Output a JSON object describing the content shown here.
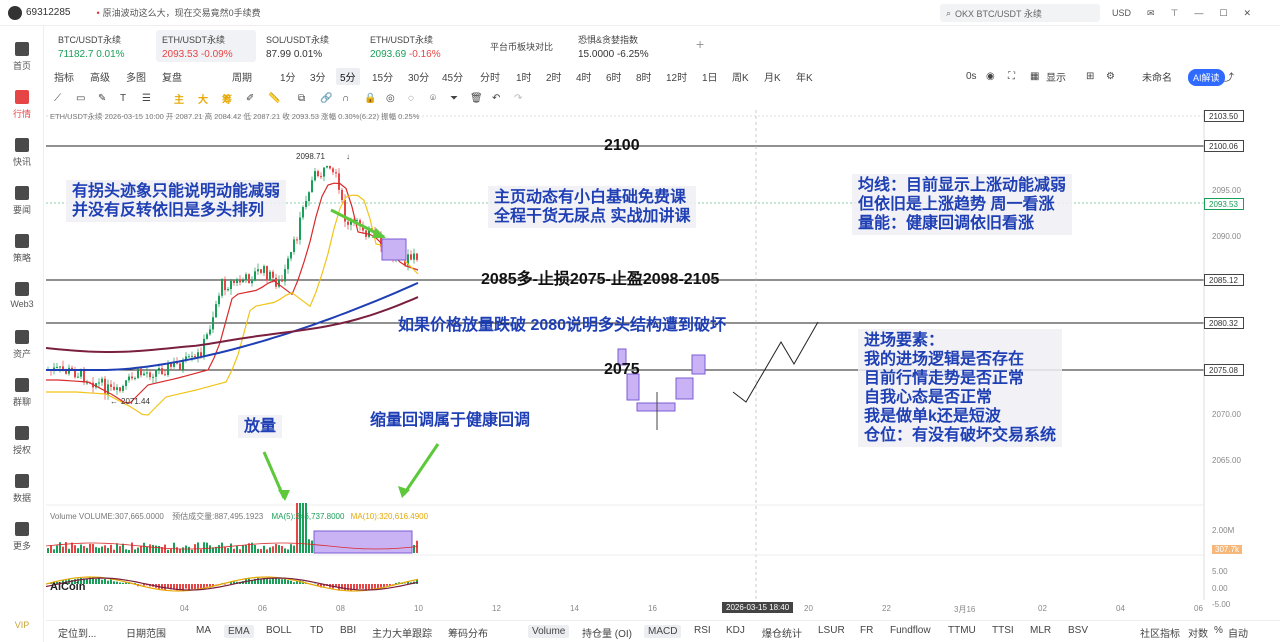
{
  "titlebar": {
    "user_id": "69312285",
    "marquee": "原油波动这么大，现在交易竟然0手续费",
    "search_placeholder": "OKX BTC/USDT 永续",
    "currency": "USD"
  },
  "nav": {
    "items": [
      "首页",
      "行情",
      "快讯",
      "要闻",
      "策略",
      "Web3",
      "资产",
      "群聊",
      "授权",
      "数据",
      "更多"
    ],
    "active": "行情",
    "vip": "VIP"
  },
  "tickers": [
    {
      "name": "BTC/USDT永续",
      "price": "71182.7",
      "change": "0.01%",
      "dir": "up"
    },
    {
      "name": "ETH/USDT永续",
      "price": "2093.53",
      "change": "-0.09%",
      "dir": "dn"
    },
    {
      "name": "SOL/USDT永续",
      "price": "87.99",
      "change": "0.01%",
      "dir": "neutral"
    },
    {
      "name": "ETH/USDT永续",
      "price": "2093.69",
      "change": "-0.16%",
      "dir": "up"
    },
    {
      "name": "平台币板块对比",
      "price": "",
      "change": "",
      "dir": "neutral"
    },
    {
      "name": "恐惧&贪婪指数",
      "price": "15.0000",
      "change": "-6.25%",
      "dir": "neutral"
    }
  ],
  "toolbar1": {
    "left": [
      "指标",
      "高级",
      "多图",
      "复盘"
    ],
    "period_label": "周期",
    "periods": [
      "1分",
      "3分",
      "5分",
      "15分",
      "30分",
      "45分",
      "分时",
      "1时",
      "2时",
      "4时",
      "6时",
      "8时",
      "12时",
      "1日",
      "周K",
      "月K",
      "年K"
    ],
    "selected_period": "5分",
    "right": [
      "0s",
      "显示",
      "未命名"
    ],
    "ai_button": "AI解读"
  },
  "toolbar2": {
    "labels": [
      "主",
      "大",
      "筹"
    ]
  },
  "info_line": "ETH/USDT永续 2026-03-15 10:00 开 2087.21 高 2084.42 低 2087.21 收 2093.53 涨幅 0.30%(6.22) 振幅 0.25%",
  "volume_line": {
    "volume": "Volume VOLUME:307,665.0000",
    "est": "预估成交量:887,495.1923",
    "ma5": "MA(5):346,737.8000",
    "ma10": "MA(10):320,616.4900"
  },
  "annotations": {
    "left_top_1": "有拐头迹象只能说明动能减弱",
    "left_top_2": "并没有反转依旧是多头排列",
    "mid_top_1": "主页动态有小白基础免费课",
    "mid_top_2": "全程干货无尿点 实战加讲课",
    "right_top_1": "均线：目前显示上涨动能减弱",
    "right_top_2": "但依旧是上涨趋势 周一看涨",
    "right_top_3": "量能：健康回调依旧看涨",
    "level_2100": "2100",
    "trade_plan": "2085多-止损2075-止盈2098-2105",
    "breakdown": "如果价格放量跌破 2080说明多头结构遭到破坏",
    "level_2075": "2075",
    "entry_title": "进场要素：",
    "entry_1": "我的进场逻辑是否存在",
    "entry_2": "目前行情走势是否正常",
    "entry_3": "自我心态是否正常",
    "entry_4": "我是做单k还是短波",
    "entry_5": "仓位：有没有破坏交易系统",
    "volume_up": "放量",
    "volume_down": "缩量回调属于健康回调",
    "high_label": "2098.71",
    "low_label": "2071.44"
  },
  "price_axis": {
    "tags": [
      "2103.50",
      "2100.06",
      "2093.53",
      "2085.12",
      "2080.32",
      "2075.08"
    ],
    "labels": [
      "2095.00",
      "2090.00",
      "2070.00",
      "2065.00"
    ],
    "vol_labels": [
      "2.00M",
      "307.7k",
      "5.00",
      "0.00",
      "-5.00"
    ]
  },
  "time_axis": {
    "labels": [
      "02",
      "04",
      "06",
      "08",
      "10",
      "12",
      "14",
      "16",
      "20",
      "22",
      "3月16",
      "02",
      "04",
      "06"
    ],
    "crosshair": "2026-03-15 18:40"
  },
  "bottombar": {
    "left": [
      "定位到...",
      "日期范围"
    ],
    "indicators": [
      "MA",
      "EMA",
      "BOLL",
      "TD",
      "BBI",
      "主力大单跟踪",
      "筹码分布",
      "Volume",
      "持仓量 (OI)",
      "MACD",
      "RSI",
      "KDJ",
      "爆仓统计",
      "LSUR",
      "FR",
      "Fundflow",
      "TTMU",
      "TTSI",
      "MLR",
      "BSV"
    ],
    "selected": [
      "EMA",
      "Volume",
      "MACD"
    ],
    "right": [
      "社区指标",
      "对数",
      "%",
      "自动"
    ]
  },
  "logo": "AiCoin",
  "colors": {
    "up": "#1a9f58",
    "down": "#e64545",
    "annotation_blue": "#1f3fb4",
    "accent": "#2f6bff"
  }
}
